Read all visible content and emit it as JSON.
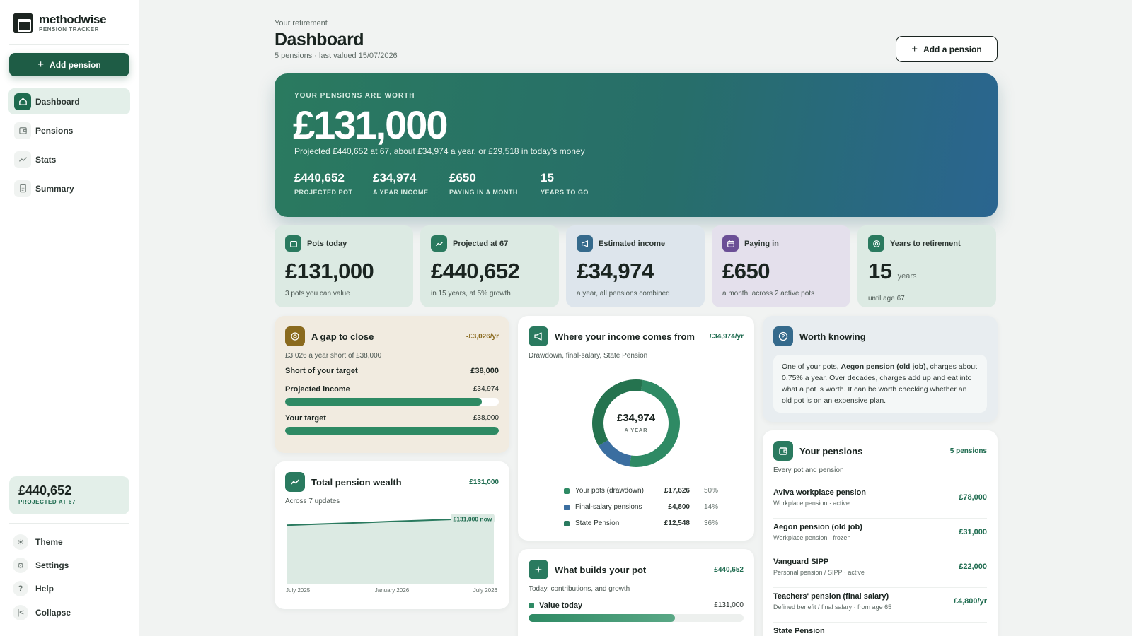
{
  "brand": {
    "name": "methodwise",
    "sub": "PENSION TRACKER"
  },
  "sidebar": {
    "add_label": "Add pension",
    "items": [
      {
        "label": "Dashboard",
        "icon": "home-icon"
      },
      {
        "label": "Pensions",
        "icon": "wallet-icon"
      },
      {
        "label": "Stats",
        "icon": "trend-icon"
      },
      {
        "label": "Summary",
        "icon": "document-icon"
      }
    ],
    "projection": {
      "value": "£440,652",
      "label": "PROJECTED AT 67"
    },
    "utilities": [
      {
        "label": "Theme",
        "icon": "sun-icon"
      },
      {
        "label": "Settings",
        "icon": "gear-icon"
      },
      {
        "label": "Help",
        "icon": "help-icon"
      },
      {
        "label": "Collapse",
        "icon": "collapse-icon"
      }
    ]
  },
  "header": {
    "eyebrow": "Your retirement",
    "title": "Dashboard",
    "subtitle": "5 pensions · last valued 15/07/2026",
    "add_button": "Add a pension"
  },
  "hero": {
    "eyebrow": "YOUR PENSIONS ARE WORTH",
    "amount": "£131,000",
    "projection": "Projected £440,652 at 67, about £34,974 a year, or £29,518 in today's money",
    "stats": [
      {
        "value": "£440,652",
        "label": "PROJECTED POT"
      },
      {
        "value": "£34,974",
        "label": "A YEAR INCOME"
      },
      {
        "value": "£650",
        "label": "PAYING IN A MONTH"
      },
      {
        "value": "15",
        "label": "YEARS TO GO"
      }
    ]
  },
  "kpis": [
    {
      "title": "Pots today",
      "value": "£131,000",
      "unit": "",
      "sub": "3 pots you can value",
      "bg": "#dceae3",
      "icon_bg": "#2a7a5f",
      "icon": "wallet-icon"
    },
    {
      "title": "Projected at 67",
      "value": "£440,652",
      "unit": "",
      "sub": "in 15 years, at 5% growth",
      "bg": "#dceae3",
      "icon_bg": "#2a7a5f",
      "icon": "trend-icon"
    },
    {
      "title": "Estimated income",
      "value": "£34,974",
      "unit": "",
      "sub": "a year, all pensions combined",
      "bg": "#dde5ec",
      "icon_bg": "#356a8c",
      "icon": "megaphone-icon"
    },
    {
      "title": "Paying in",
      "value": "£650",
      "unit": "",
      "sub": "a month, across 2 active pots",
      "bg": "#e4e0ec",
      "icon_bg": "#6b4f96",
      "icon": "calendar-icon"
    },
    {
      "title": "Years to retirement",
      "value": "15",
      "unit": "years",
      "sub": "until age 67",
      "bg": "#dceae3",
      "icon_bg": "#2a7a5f",
      "icon": "target-icon"
    }
  ],
  "gap": {
    "title": "A gap to close",
    "badge": "-£3,026/yr",
    "sub": "£3,026 a year short of £38,000",
    "short_label": "Short of your target",
    "short_value": "£38,000",
    "projected_label": "Projected income",
    "projected_value": "£34,974",
    "projected_fraction": 0.92,
    "target_label": "Your target",
    "target_value": "£38,000",
    "target_fraction": 1.0
  },
  "wealth": {
    "title": "Total pension wealth",
    "badge": "£131,000",
    "sub": "Across 7 updates",
    "now_label": "£131,000 now",
    "x_ticks": [
      "July 2025",
      "January 2026",
      "July 2026"
    ]
  },
  "chart_data": {
    "type": "area",
    "title": "Total pension wealth",
    "x": [
      "July 2025",
      "",
      "",
      "",
      "",
      "",
      "July 2026"
    ],
    "values": [
      126500,
      127300,
      128000,
      128800,
      129500,
      130300,
      131000
    ],
    "ylim": [
      0,
      131000
    ],
    "grid": false
  },
  "income": {
    "title": "Where your income comes from",
    "badge": "£34,974/yr",
    "sub": "Drawdown, final-salary, State Pension",
    "center_value": "£34,974",
    "center_label": "A YEAR",
    "sources": [
      {
        "name": "Your pots (drawdown)",
        "value": "£17,626",
        "pct": "50%",
        "fraction": 0.5,
        "color": "#2e8a64"
      },
      {
        "name": "Final-salary pensions",
        "value": "£4,800",
        "pct": "14%",
        "fraction": 0.14,
        "color": "#3b6ea0"
      },
      {
        "name": "State Pension",
        "value": "£12,548",
        "pct": "36%",
        "fraction": 0.36,
        "color": "#2a7a5f"
      }
    ]
  },
  "builds": {
    "title": "What builds your pot",
    "badge": "£440,652",
    "sub": "Today, contributions, and growth",
    "row_label": "Value today",
    "row_value": "£131,000",
    "row_fraction": 0.68
  },
  "worth_knowing": {
    "title": "Worth knowing",
    "text_before": "One of your pots, ",
    "text_bold": "Aegon pension (old job)",
    "text_after": ", charges about 0.75% a year. Over decades, charges add up and eat into what a pot is worth. It can be worth checking whether an old pot is on an expensive plan."
  },
  "pensions": {
    "title": "Your pensions",
    "badge": "5 pensions",
    "sub": "Every pot and pension",
    "list": [
      {
        "name": "Aviva workplace pension",
        "meta": "Workplace pension · active",
        "value": "£78,000"
      },
      {
        "name": "Aegon pension (old job)",
        "meta": "Workplace pension · frozen",
        "value": "£31,000"
      },
      {
        "name": "Vanguard SIPP",
        "meta": "Personal pension / SIPP · active",
        "value": "£22,000"
      },
      {
        "name": "Teachers' pension (final salary)",
        "meta": "Defined benefit / final salary · from age 65",
        "value": "£4,800/yr"
      },
      {
        "name": "State Pension",
        "meta": "",
        "value": ""
      }
    ]
  }
}
